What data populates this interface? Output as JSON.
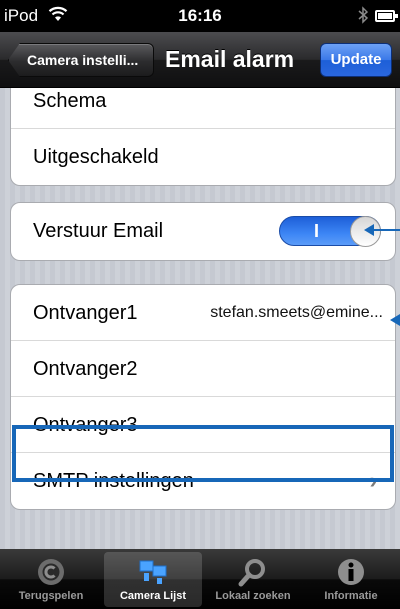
{
  "status_bar": {
    "carrier": "iPod",
    "time": "16:16"
  },
  "nav": {
    "back_label": "Camera instelli...",
    "title": "Email alarm",
    "update_label": "Update"
  },
  "sections": {
    "schedule": [
      {
        "label": "Schema"
      },
      {
        "label": "Uitgeschakeld"
      }
    ],
    "email": {
      "label": "Verstuur Email",
      "toggle_on_label": "I"
    },
    "recipients": [
      {
        "label": "Ontvanger1",
        "value": "stefan.smeets@emine..."
      },
      {
        "label": "Ontvanger2",
        "value": ""
      },
      {
        "label": "Ontvanger3",
        "value": ""
      },
      {
        "label": "SMTP instellingen",
        "chevron": "›"
      }
    ]
  },
  "tabs": [
    {
      "label": "Terugspelen",
      "icon": "playback-icon",
      "active": false
    },
    {
      "label": "Camera Lijst",
      "icon": "camera-list-icon",
      "active": true
    },
    {
      "label": "Lokaal zoeken",
      "icon": "search-icon",
      "active": false
    },
    {
      "label": "Informatie",
      "icon": "info-icon",
      "active": false
    }
  ],
  "colors": {
    "accent": "#1767b8",
    "toggle_blue": "#3d86f5",
    "update_blue": "#2a67de"
  }
}
